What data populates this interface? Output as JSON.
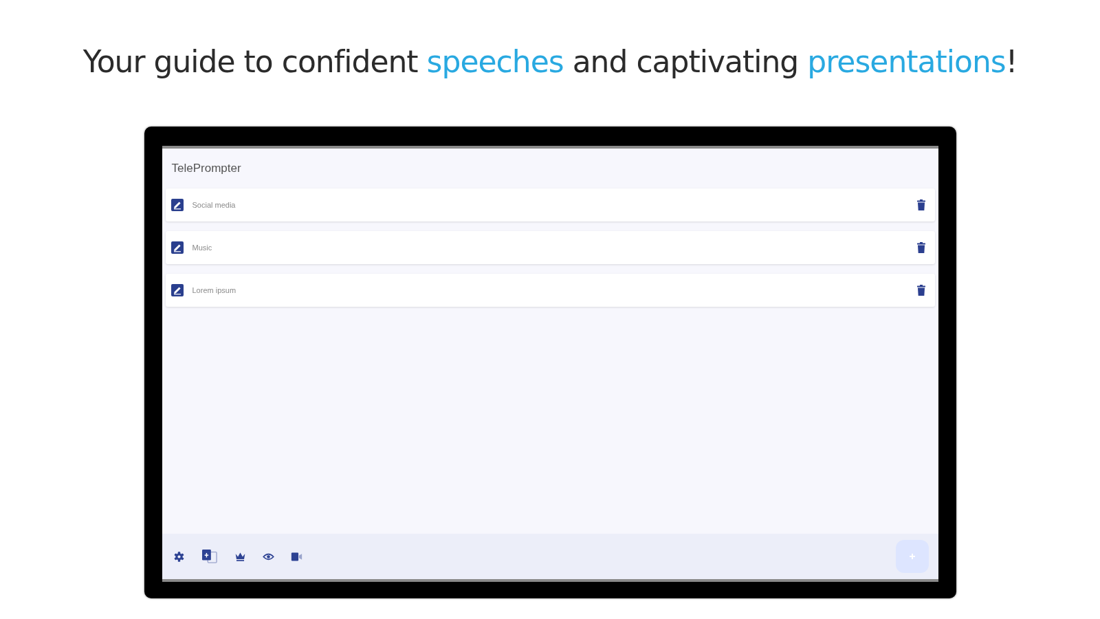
{
  "headline": [
    {
      "text": "Your guide to confident ",
      "highlight": false
    },
    {
      "text": "speeches",
      "highlight": true
    },
    {
      "text": " and captivating ",
      "highlight": false
    },
    {
      "text": "presentations",
      "highlight": true
    },
    {
      "text": "!",
      "highlight": false
    }
  ],
  "app": {
    "title": "TelePrompter",
    "scripts": [
      {
        "title": "Social media"
      },
      {
        "title": "Music"
      },
      {
        "title": "Lorem ipsum"
      }
    ]
  }
}
